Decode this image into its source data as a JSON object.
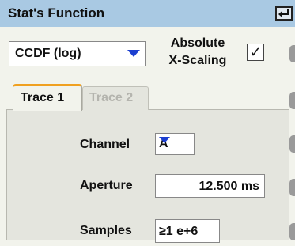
{
  "window": {
    "title": "Stat's Function"
  },
  "function_select": {
    "value": "CCDF (log)"
  },
  "absolute_scaling": {
    "label_line1": "Absolute",
    "label_line2": "X-Scaling",
    "checked_glyph": "✓"
  },
  "tabs": [
    {
      "label": "Trace 1",
      "active": true
    },
    {
      "label": "Trace 2",
      "active": false
    }
  ],
  "channel": {
    "label": "Channel",
    "value": "A"
  },
  "aperture": {
    "label": "Aperture",
    "value": "12.500 ms"
  },
  "samples": {
    "label": "Samples",
    "value": "≥1 e+6"
  },
  "colors": {
    "titlebar": "#a9c9e3",
    "arrow": "#1c3fd0",
    "active_tab_accent": "#f0a020"
  }
}
